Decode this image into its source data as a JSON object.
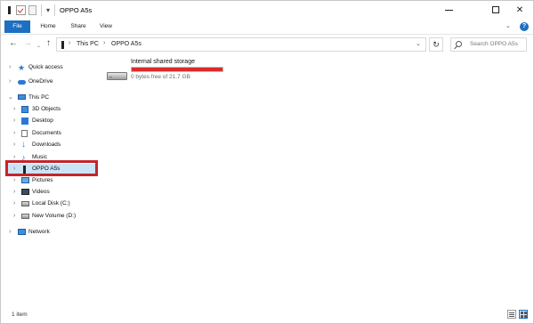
{
  "window": {
    "title": "OPPO A5s"
  },
  "ribbon": {
    "tabs": [
      "File",
      "Home",
      "Share",
      "View"
    ]
  },
  "address": {
    "crumbs": [
      "This PC",
      "OPPO A5s"
    ],
    "search_placeholder": "Search OPPO A5s"
  },
  "nav": {
    "items": [
      {
        "label": "Quick access",
        "icon": "star-icon"
      },
      {
        "label": "OneDrive",
        "icon": "cloud-icon"
      },
      {
        "label": "This PC",
        "icon": "computer-icon"
      },
      {
        "label": "3D Objects",
        "icon": "cube-icon"
      },
      {
        "label": "Desktop",
        "icon": "desktop-icon"
      },
      {
        "label": "Documents",
        "icon": "document-icon"
      },
      {
        "label": "Downloads",
        "icon": "download-icon"
      },
      {
        "label": "Music",
        "icon": "music-icon"
      },
      {
        "label": "OPPO A5s",
        "icon": "phone-icon",
        "selected": true
      },
      {
        "label": "Pictures",
        "icon": "picture-icon"
      },
      {
        "label": "Videos",
        "icon": "video-icon"
      },
      {
        "label": "Local Disk (C:)",
        "icon": "disk-icon"
      },
      {
        "label": "New Volume (D:)",
        "icon": "disk-icon"
      },
      {
        "label": "Network",
        "icon": "network-icon"
      }
    ]
  },
  "content": {
    "storage_name": "Internal shared storage",
    "storage_info": "0 bytes free of 21.7 GB",
    "storage_used_fraction": 1.0,
    "bar_color": "#da2b2b"
  },
  "status": {
    "item_count": "1 item"
  },
  "colors": {
    "accent": "#1e6fc1",
    "highlight": "#c4252b"
  }
}
